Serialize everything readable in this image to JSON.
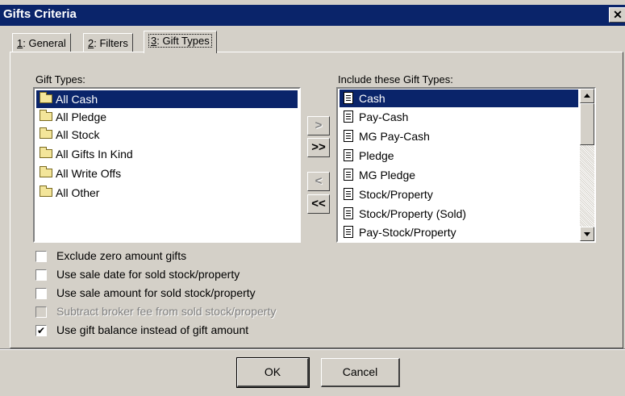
{
  "window": {
    "title": "Gifts Criteria",
    "close_glyph": "✕"
  },
  "tabs": [
    {
      "key": "1",
      "label": ": General"
    },
    {
      "key": "2",
      "label": ": Filters"
    },
    {
      "key": "3",
      "label": ": Gift Types",
      "active": true
    }
  ],
  "left_list": {
    "label": "Gift Types:",
    "items": [
      "All Cash",
      "All Pledge",
      "All Stock",
      "All Gifts In Kind",
      "All Write Offs",
      "All Other"
    ],
    "selected_index": 0,
    "icon": "folder-icon"
  },
  "right_list": {
    "label": "Include these Gift Types:",
    "items": [
      "Cash",
      "Pay-Cash",
      "MG Pay-Cash",
      "Pledge",
      "MG Pledge",
      "Stock/Property",
      "Stock/Property (Sold)",
      "Pay-Stock/Property"
    ],
    "selected_index": 0,
    "icon": "document-icon"
  },
  "move_buttons": {
    "add": ">",
    "add_all": ">>",
    "remove": "<",
    "remove_all": "<<"
  },
  "options": [
    {
      "label": "Exclude zero amount gifts",
      "checked": false,
      "enabled": true
    },
    {
      "label": "Use sale date for sold stock/property",
      "checked": false,
      "enabled": true
    },
    {
      "label": "Use sale amount for sold stock/property",
      "checked": false,
      "enabled": true
    },
    {
      "label": "Subtract broker fee from sold stock/property",
      "checked": false,
      "enabled": false
    },
    {
      "label": "Use gift balance instead of gift amount",
      "checked": true,
      "enabled": true
    }
  ],
  "buttons": {
    "ok": "OK",
    "cancel": "Cancel"
  },
  "colors": {
    "selection": "#0a246a",
    "face": "#d4d0c8"
  }
}
